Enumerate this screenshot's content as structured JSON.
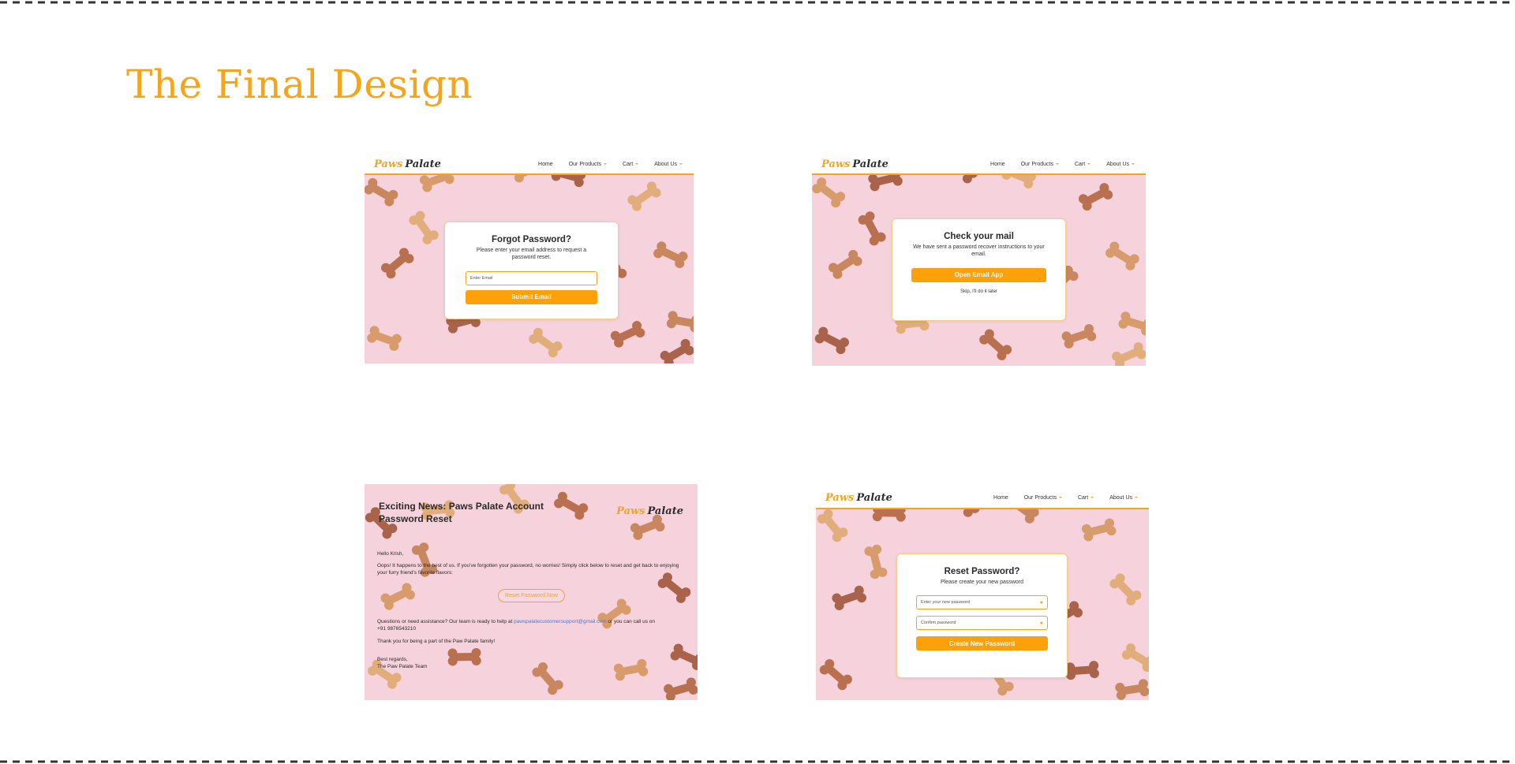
{
  "page": {
    "title": "The Final Design",
    "accent_color": "#f4a51c",
    "button_color": "#fea00a",
    "background_color": "#f6d2dd"
  },
  "logo": {
    "accent": "Paws",
    "name": "Palate"
  },
  "nav": {
    "home": "Home",
    "products": "Our Products",
    "cart": "Cart",
    "about": "About Us"
  },
  "forgot": {
    "heading": "Forgot Password?",
    "description": "Please enter your email address to request a password reset.",
    "email_placeholder": "Enter Email",
    "submit_label": "Submit Email"
  },
  "check_mail": {
    "heading": "Check your mail",
    "description": "We have sent a password recover instructions to your email.",
    "open_label": "Open Email App",
    "skip_label": "Skip, I'll do it later"
  },
  "email": {
    "title": "Exciting News: Paws Palate Account Password Reset",
    "greeting": "Hello  Krish,",
    "body": "Oops! It happens to the best of us. If you've forgotten your password, no worries! Simply click below to reset and get back to enjoying your furry friend's favorite flavors:",
    "button_label": "Reset Password Now",
    "help_prefix": "Questions or need assistance? Our team is ready to help at",
    "help_email": "pawspalatecustomersupport@gmail.com",
    "help_suffix": "or you can call us on",
    "phone": "+91 9876543210",
    "thanks": "Thank you for being a part of the Paw Palate family!",
    "signoff": "Best regards,",
    "team": "The Paw Palate Team"
  },
  "reset": {
    "heading": "Reset Password?",
    "description": "Please create your new password",
    "new_placeholder": "Enter your new password",
    "confirm_placeholder": "Confirm password",
    "create_label": "Create New Password"
  },
  "icons": {
    "dropdown": "chevron-down-icon",
    "password_toggle": "eye-icon",
    "background": "dog-bone-treat"
  }
}
